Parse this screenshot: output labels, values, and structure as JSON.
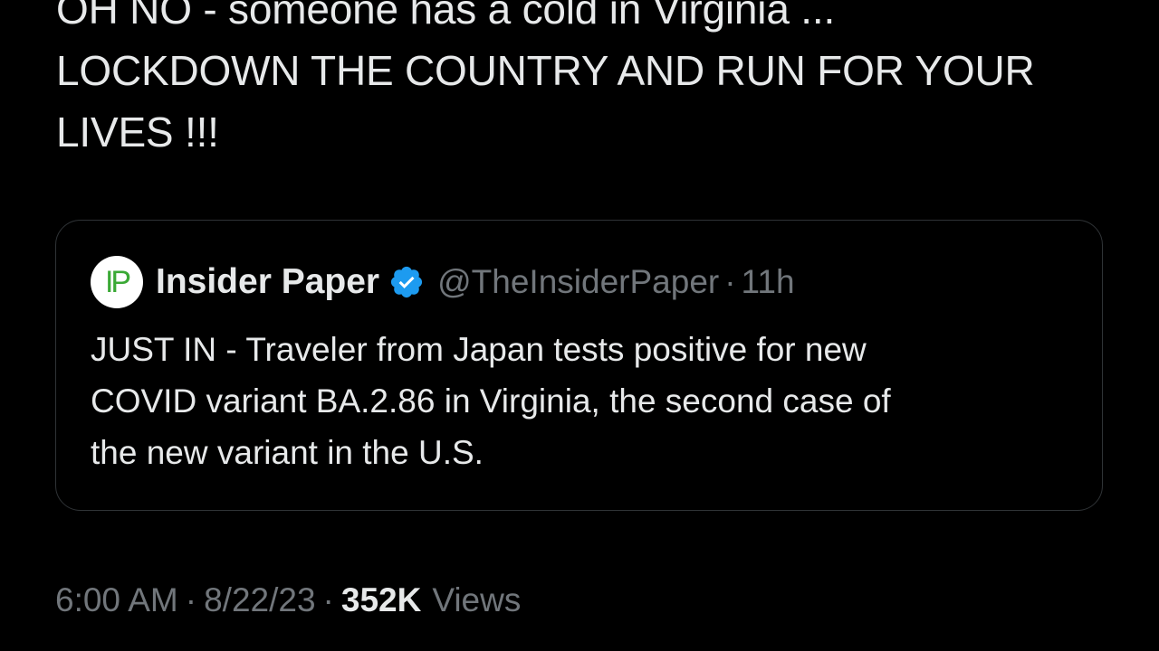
{
  "tweet": {
    "text_lines": [
      "OH NO - someone has a cold in Virginia ...",
      "LOCKDOWN THE COUNTRY AND RUN FOR YOUR",
      "LIVES !!!"
    ]
  },
  "quote": {
    "avatar_text": "IP",
    "display_name": "Insider Paper",
    "verified_icon": "verified-badge-icon",
    "handle": "@TheInsiderPaper",
    "separator": "·",
    "time_ago": "11h",
    "body_lines": [
      "JUST IN - Traveler from Japan tests positive for new",
      "COVID variant BA.2.86 in Virginia, the second case of",
      "the new variant in the U.S."
    ]
  },
  "meta": {
    "time": "6:00 AM",
    "separator": "·",
    "date": "8/22/23",
    "views_count": "352K",
    "views_label": "Views"
  },
  "colors": {
    "background": "#000000",
    "primary_text": "#e7e9ea",
    "secondary_text": "#71767b",
    "border": "#2f3336",
    "verified": "#1d9bf0",
    "avatar_accent": "#3aa935"
  }
}
